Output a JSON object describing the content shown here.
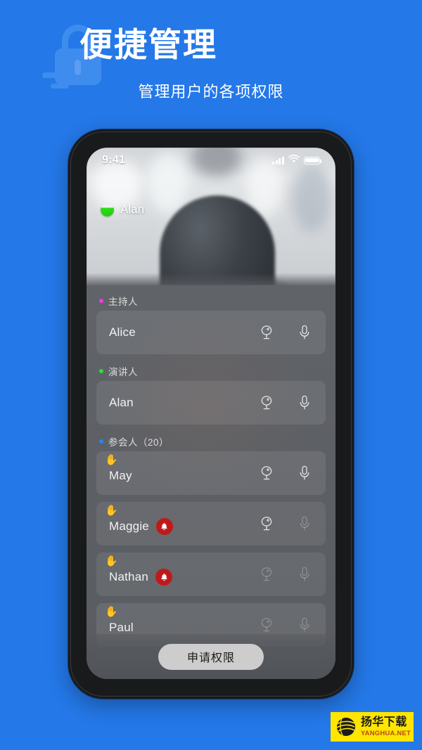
{
  "hero": {
    "title": "便捷管理",
    "subtitle": "管理用户的各项权限",
    "bg_color": "#2478e8",
    "watermark_icon": "lock-icon"
  },
  "phone": {
    "status_bar": {
      "time": "9:41",
      "signal_icon": "signal-bars-icon",
      "wifi_icon": "wifi-icon",
      "battery_icon": "battery-icon"
    },
    "video": {
      "self_name": "Alan",
      "quality_icon": "connection-quality-icon"
    },
    "sections": [
      {
        "label": "主持人",
        "dot_color": "#f637ec",
        "rows": [
          {
            "name": "Alice",
            "hand_raised": false,
            "bell": false,
            "camera_enabled": true,
            "mic_enabled": true
          }
        ]
      },
      {
        "label": "演讲人",
        "dot_color": "#2ee02e",
        "rows": [
          {
            "name": "Alan",
            "hand_raised": false,
            "bell": false,
            "camera_enabled": true,
            "mic_enabled": true
          }
        ]
      },
      {
        "label": "参会人（20）",
        "dot_color": "#2b84f0",
        "rows": [
          {
            "name": "May",
            "hand_raised": true,
            "bell": false,
            "camera_enabled": true,
            "mic_enabled": true
          },
          {
            "name": "Maggie",
            "hand_raised": true,
            "bell": true,
            "camera_enabled": true,
            "mic_enabled": false
          },
          {
            "name": "Nathan",
            "hand_raised": true,
            "bell": true,
            "camera_enabled": false,
            "mic_enabled": false
          },
          {
            "name": "Paul",
            "hand_raised": true,
            "bell": false,
            "camera_enabled": false,
            "mic_enabled": false
          }
        ]
      }
    ],
    "bottom_bar": {
      "request_label": "申请权限"
    },
    "icons": {
      "hand": "✋",
      "camera": "camera-icon",
      "mic": "microphone-icon",
      "bell": "bell-icon"
    }
  },
  "site_watermark": {
    "cn": "扬华下载",
    "en": "YANGHUA.NET",
    "bg_color": "#ffe500"
  }
}
